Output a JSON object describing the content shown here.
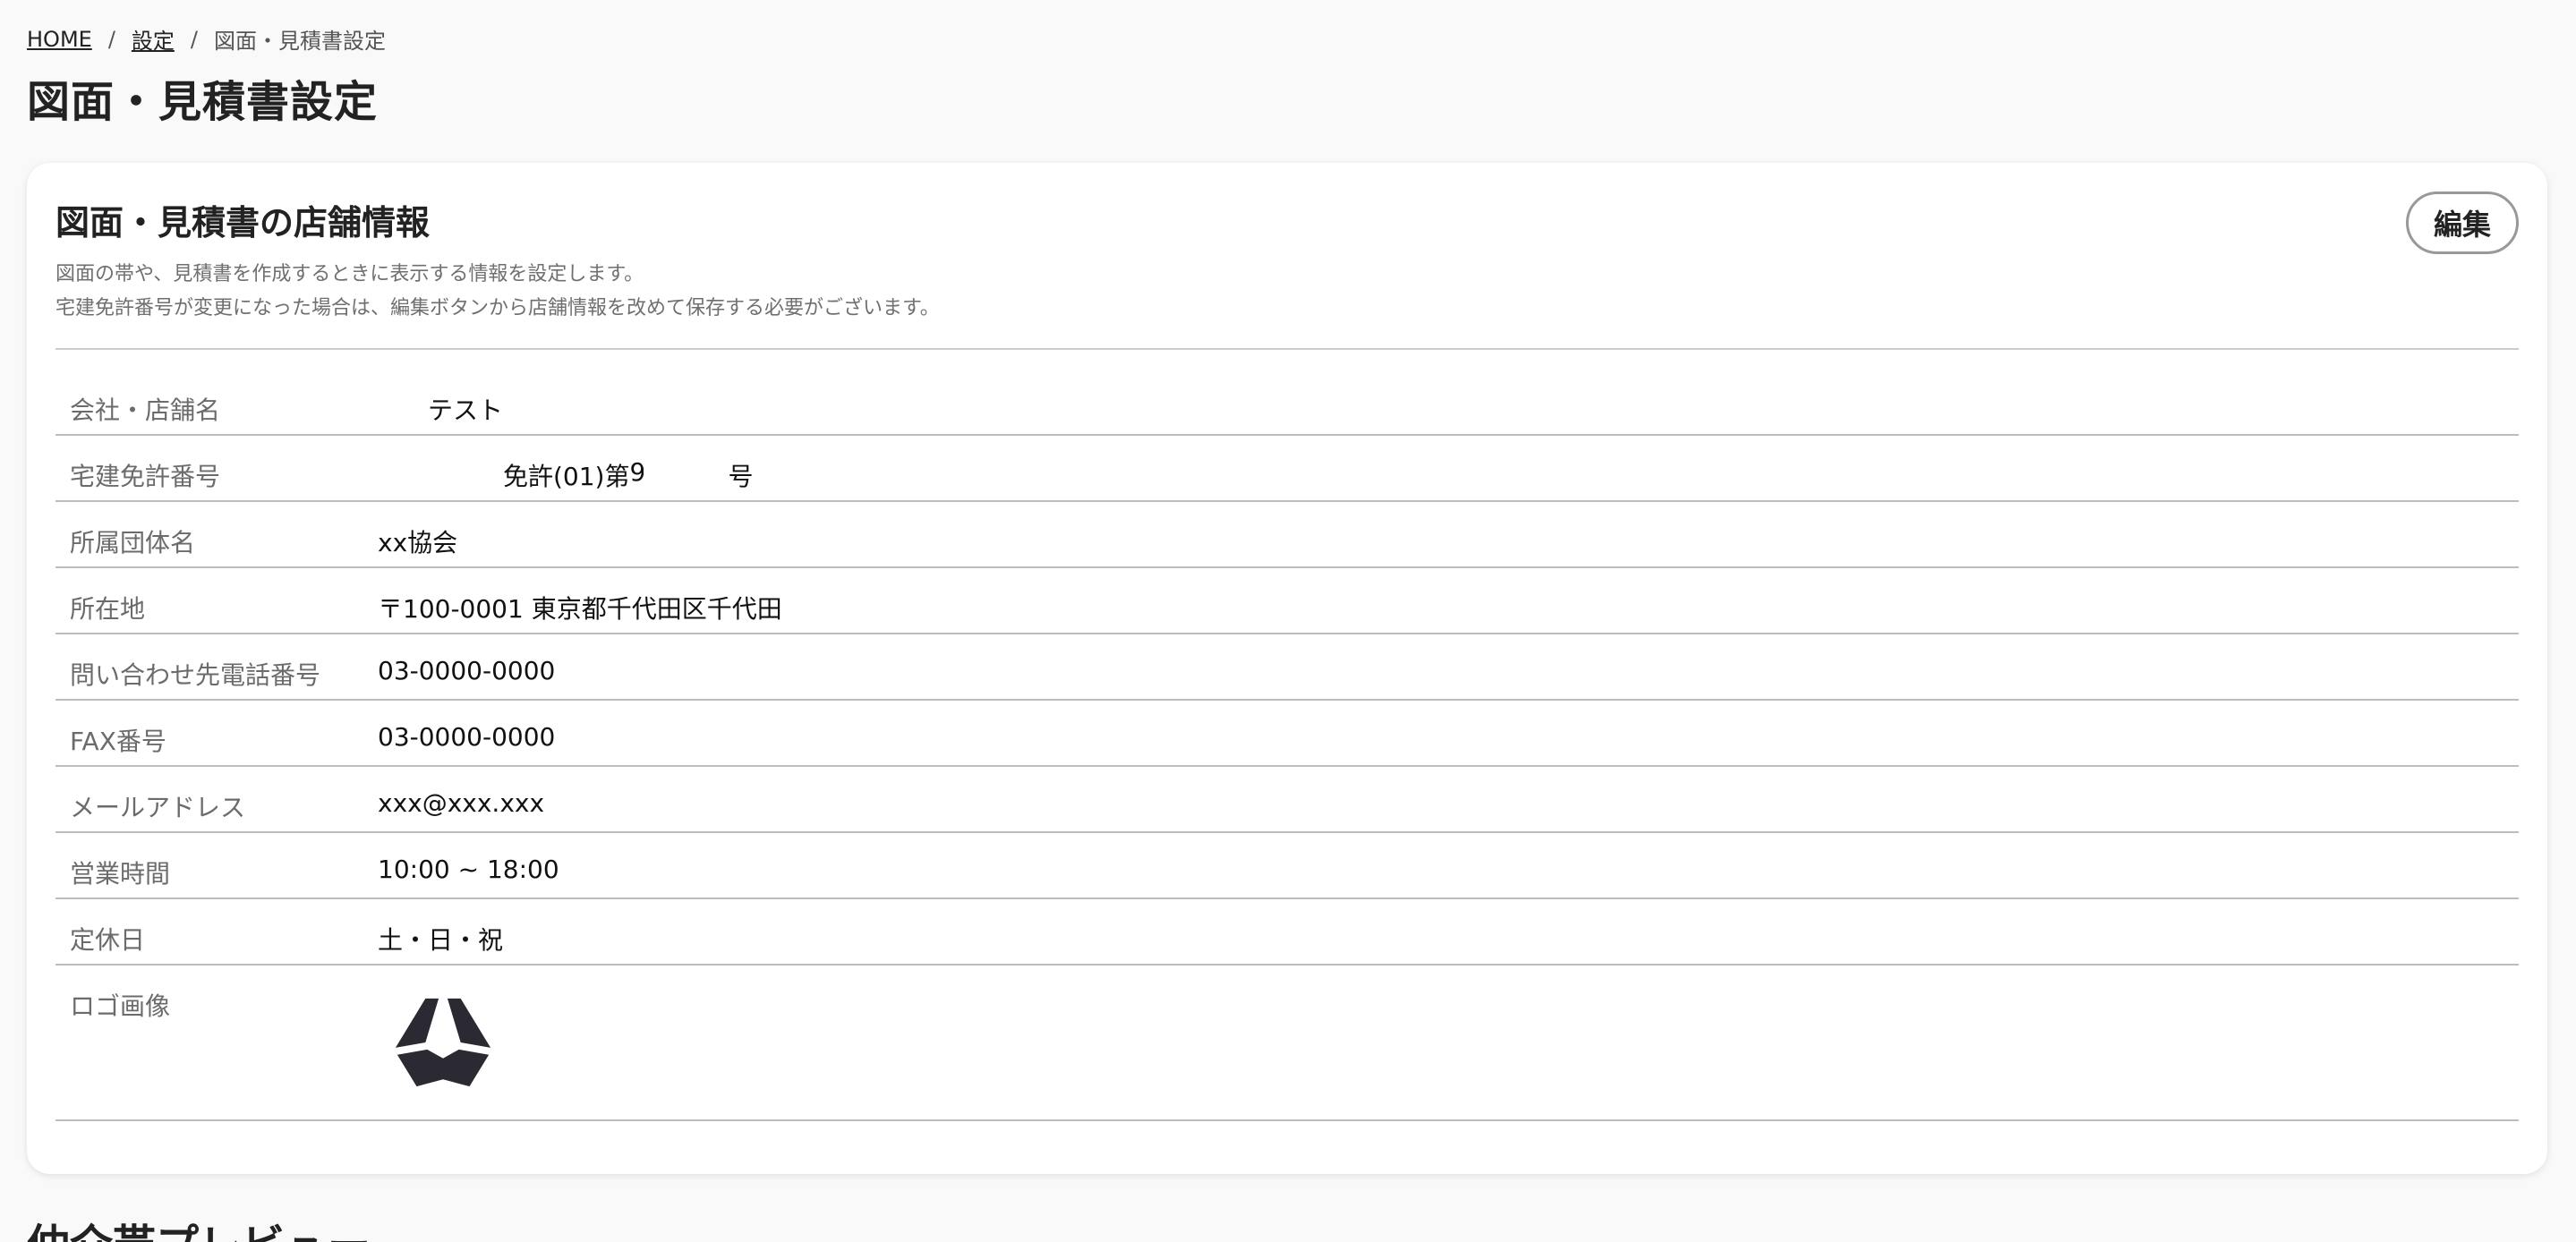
{
  "breadcrumb": {
    "home": "HOME",
    "separator": "/",
    "settings": "設定",
    "current": "図面・見積書設定"
  },
  "page_title": "図面・見積書設定",
  "store_info": {
    "title": "図面・見積書の店舗情報",
    "description_line1": "図面の帯や、見積書を作成するときに表示する情報を設定します。",
    "description_line2": "宅建免許番号が変更になった場合は、編集ボタンから店舗情報を改めて保存する必要がございます。",
    "edit_label": "編集",
    "rows": {
      "company": {
        "label": "会社・店舗名",
        "value": "テスト"
      },
      "license": {
        "label": "宅建免許番号",
        "prefix": "免許(01)第",
        "number": "9",
        "suffix": "号"
      },
      "association": {
        "label": "所属団体名",
        "value": "xx協会"
      },
      "address": {
        "label": "所在地",
        "value": "〒100-0001 東京都千代田区千代田"
      },
      "phone": {
        "label": "問い合わせ先電話番号",
        "value": "03-0000-0000"
      },
      "fax": {
        "label": "FAX番号",
        "value": "03-0000-0000"
      },
      "email": {
        "label": "メールアドレス",
        "value": "xxx@xxx.xxx"
      },
      "hours": {
        "label": "営業時間",
        "value": "10:00 ~ 18:00"
      },
      "holidays": {
        "label": "定休日",
        "value": "土・日・祝"
      },
      "logo": {
        "label": "ロゴ画像",
        "icon": "logo-mark",
        "color": "#2b2a33"
      }
    }
  },
  "next_section_title": "仲介帯プレビュー"
}
